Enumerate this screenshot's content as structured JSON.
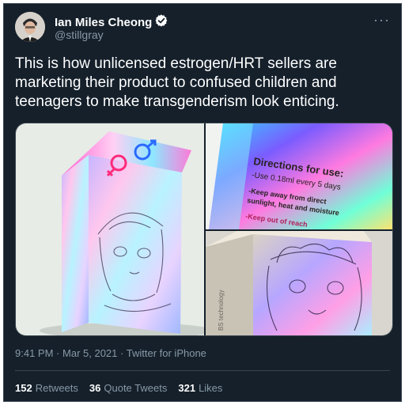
{
  "author": {
    "name": "Ian Miles Cheong",
    "handle": "@stillgray",
    "verified_icon": "verified-badge-icon"
  },
  "menu_icon": "more-options-icon",
  "tweet": {
    "text": "This is how unlicensed estrogen/HRT sellers are marketing their product to confused children and teenagers to make transgenderism look enticing."
  },
  "photos": {
    "box_text": {
      "heading": "Directions for use:",
      "line1": "-Use 0.18ml every 5 days",
      "line2": "-Keep away from direct",
      "line3": "sunlight, heat and moisture",
      "line4": "-Keep out of reach",
      "side": "BS technology"
    }
  },
  "meta": {
    "time": "9:41 PM",
    "sep1": "·",
    "date": "Mar 5, 2021",
    "sep2": "·",
    "source": "Twitter for iPhone"
  },
  "stats": {
    "retweets_count": "152",
    "retweets_label": "Retweets",
    "quotes_count": "36",
    "quotes_label": "Quote Tweets",
    "likes_count": "321",
    "likes_label": "Likes"
  },
  "colors": {
    "background": "#15202b",
    "text": "#ffffff",
    "secondary_text": "#8899a6",
    "border": "#38444d",
    "verified": "#ffffff"
  }
}
